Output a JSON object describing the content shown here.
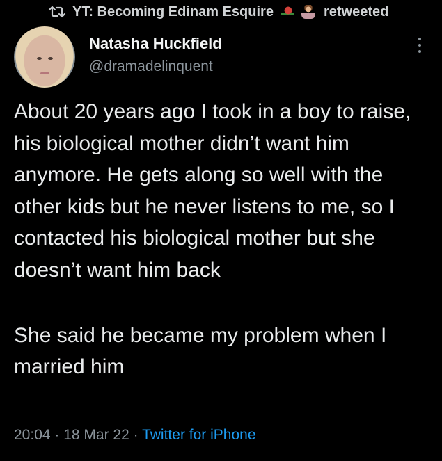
{
  "retweet": {
    "icon": "retweet-icon",
    "name": "YT: Becoming Edinam Esquire",
    "emoji": [
      "rose-emoji",
      "woman-judge-emoji"
    ],
    "label": "retweeted"
  },
  "author": {
    "display_name": "Natasha Huckfield",
    "handle": "@dramadelinquent",
    "avatar": "profile-photo"
  },
  "tweet": {
    "paragraphs": [
      "About 20 years ago I took in a boy to raise, his biological mother didn’t want him anymore. He gets along so well with the other kids but he never listens to me, so I contacted his biological mother but she doesn’t want him back",
      "She said he became my problem when I married him"
    ]
  },
  "meta": {
    "time": "20:04",
    "separator": " · ",
    "date": "18 Mar 22",
    "source": "Twitter for iPhone"
  },
  "colors": {
    "background": "#000000",
    "text": "#e7e9ea",
    "secondary": "#8b949b",
    "link": "#1d9bf0"
  }
}
